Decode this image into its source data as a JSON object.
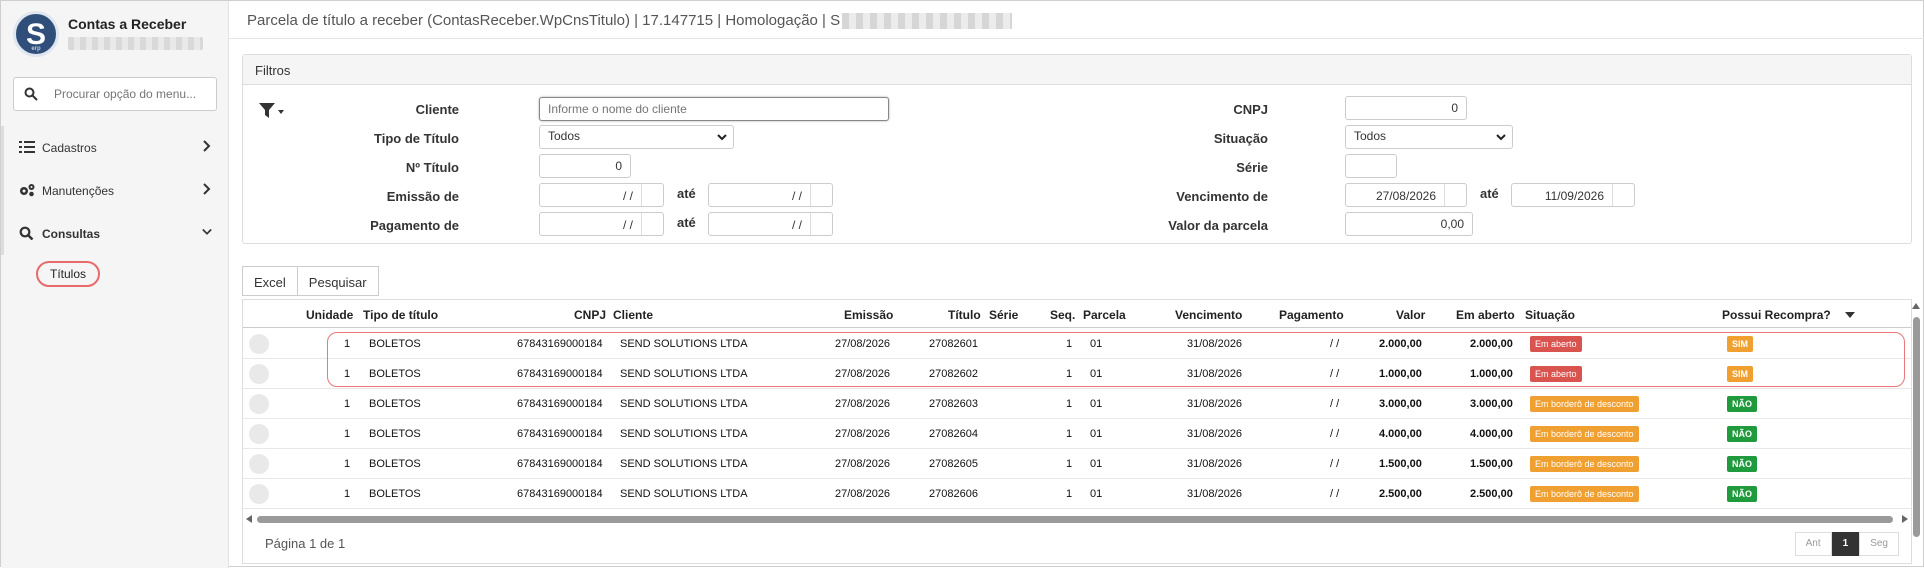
{
  "app": {
    "title": "Contas a Receber",
    "logo_letter": "S",
    "logo_sub": "erp"
  },
  "sidebar": {
    "search_placeholder": "Procurar opção do menu...",
    "items": [
      {
        "label": "Cadastros",
        "icon": "list-icon"
      },
      {
        "label": "Manutenções",
        "icon": "gears-icon"
      },
      {
        "label": "Consultas",
        "icon": "search-icon"
      }
    ],
    "sub_items": [
      {
        "label": "Títulos"
      }
    ]
  },
  "header": {
    "title": "Parcela de título a receber (ContasReceber.WpCnsTitulo) | 17.147715 | Homologação | S"
  },
  "filters": {
    "panel_title": "Filtros",
    "labels": {
      "cliente": "Cliente",
      "tipo_titulo": "Tipo de Título",
      "num_titulo": "Nº Título",
      "emissao_de": "Emissão de",
      "pagamento_de": "Pagamento de",
      "cnpj": "CNPJ",
      "situacao": "Situação",
      "serie": "Série",
      "vencimento_de": "Vencimento de",
      "valor_parcela": "Valor da parcela",
      "ate": "até"
    },
    "values": {
      "cliente_placeholder": "Informe o nome do cliente",
      "tipo_titulo": "Todos",
      "num_titulo": "0",
      "emissao_de": "/ /",
      "emissao_ate": "/ /",
      "pagamento_de": "/ /",
      "pagamento_ate": "/ /",
      "cnpj": "0",
      "situacao": "Todos",
      "serie": "",
      "vencimento_de": "27/08/2026",
      "vencimento_ate": "11/09/2026",
      "valor_parcela": "0,00"
    }
  },
  "toolbar": {
    "excel_label": "Excel",
    "search_label": "Pesquisar"
  },
  "grid": {
    "columns": [
      "Unidade",
      "Tipo de título",
      "CNPJ",
      "Cliente",
      "Emissão",
      "Título",
      "Série",
      "Seq.",
      "Parcela",
      "Vencimento",
      "Pagamento",
      "Valor",
      "Em aberto",
      "Situação",
      "Possui Recompra?"
    ],
    "rows": [
      {
        "unidade": "1",
        "tipo": "BOLETOS",
        "cnpj": "67843169000184",
        "cliente": "SEND SOLUTIONS LTDA",
        "emissao": "27/08/2026",
        "titulo": "27082601",
        "serie": "",
        "seq": "1",
        "parcela": "01",
        "vencimento": "31/08/2026",
        "pagamento": "/ /",
        "valor": "2.000,00",
        "aberto": "2.000,00",
        "situacao": "Em aberto",
        "recompra": "SIM"
      },
      {
        "unidade": "1",
        "tipo": "BOLETOS",
        "cnpj": "67843169000184",
        "cliente": "SEND SOLUTIONS LTDA",
        "emissao": "27/08/2026",
        "titulo": "27082602",
        "serie": "",
        "seq": "1",
        "parcela": "01",
        "vencimento": "31/08/2026",
        "pagamento": "/ /",
        "valor": "1.000,00",
        "aberto": "1.000,00",
        "situacao": "Em aberto",
        "recompra": "SIM"
      },
      {
        "unidade": "1",
        "tipo": "BOLETOS",
        "cnpj": "67843169000184",
        "cliente": "SEND SOLUTIONS LTDA",
        "emissao": "27/08/2026",
        "titulo": "27082603",
        "serie": "",
        "seq": "1",
        "parcela": "01",
        "vencimento": "31/08/2026",
        "pagamento": "/ /",
        "valor": "3.000,00",
        "aberto": "3.000,00",
        "situacao": "Em borderô de desconto",
        "recompra": "NÃO"
      },
      {
        "unidade": "1",
        "tipo": "BOLETOS",
        "cnpj": "67843169000184",
        "cliente": "SEND SOLUTIONS LTDA",
        "emissao": "27/08/2026",
        "titulo": "27082604",
        "serie": "",
        "seq": "1",
        "parcela": "01",
        "vencimento": "31/08/2026",
        "pagamento": "/ /",
        "valor": "4.000,00",
        "aberto": "4.000,00",
        "situacao": "Em borderô de desconto",
        "recompra": "NÃO"
      },
      {
        "unidade": "1",
        "tipo": "BOLETOS",
        "cnpj": "67843169000184",
        "cliente": "SEND SOLUTIONS LTDA",
        "emissao": "27/08/2026",
        "titulo": "27082605",
        "serie": "",
        "seq": "1",
        "parcela": "01",
        "vencimento": "31/08/2026",
        "pagamento": "/ /",
        "valor": "1.500,00",
        "aberto": "1.500,00",
        "situacao": "Em borderô de desconto",
        "recompra": "NÃO"
      },
      {
        "unidade": "1",
        "tipo": "BOLETOS",
        "cnpj": "67843169000184",
        "cliente": "SEND SOLUTIONS LTDA",
        "emissao": "27/08/2026",
        "titulo": "27082606",
        "serie": "",
        "seq": "1",
        "parcela": "01",
        "vencimento": "31/08/2026",
        "pagamento": "/ /",
        "valor": "2.500,00",
        "aberto": "2.500,00",
        "situacao": "Em borderô de desconto",
        "recompra": "NÃO"
      }
    ],
    "pager_text": "Página 1 de 1",
    "pager": {
      "prev": "Ant",
      "current": "1",
      "next": "Seg"
    }
  },
  "colors": {
    "status_open": "#d9534f",
    "status_discount": "#f0a030",
    "recompra_sim": "#f0a030",
    "recompra_nao": "#1f9a3c",
    "highlight": "#e8787a"
  }
}
